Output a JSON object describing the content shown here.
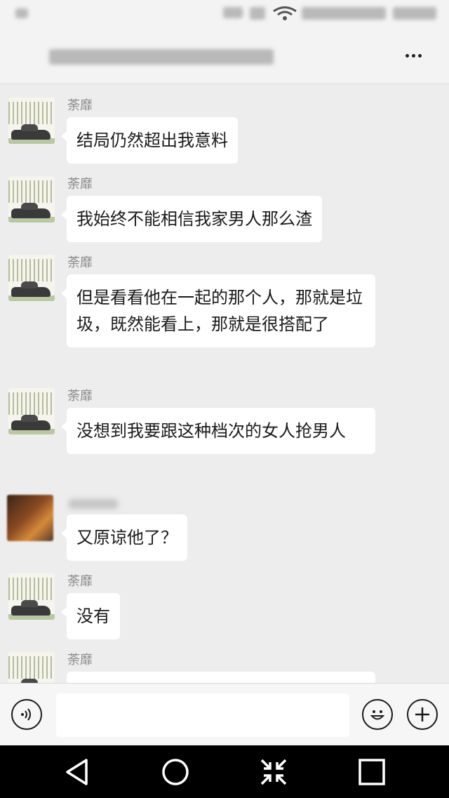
{
  "messages": [
    {
      "sender": "荼靡",
      "text": "结局仍然超出我意料"
    },
    {
      "sender": "荼靡",
      "text": "我始终不能相信我家男人那么渣"
    },
    {
      "sender": "荼靡",
      "text": "但是看看他在一起的那个人，那就是垃圾，既然能看上，那就是很搭配了"
    },
    {
      "sender": "荼靡",
      "text": "没想到我要跟这种档次的女人抢男人"
    },
    {
      "sender": "",
      "text": "又原谅他了？"
    },
    {
      "sender": "荼靡",
      "text": "没有"
    },
    {
      "sender": "荼靡",
      "text": ""
    }
  ],
  "colors": {
    "bubble": "#ffffff",
    "background": "#ededed",
    "nav": "#000000"
  },
  "icons": {
    "header_more": "more-dots-icon",
    "voice": "voice-icon",
    "emoji": "emoji-icon",
    "add": "plus-icon",
    "nav_back": "back-triangle-icon",
    "nav_home": "home-circle-icon",
    "nav_shrink": "shrink-arrows-icon",
    "nav_recent": "recent-square-icon"
  }
}
